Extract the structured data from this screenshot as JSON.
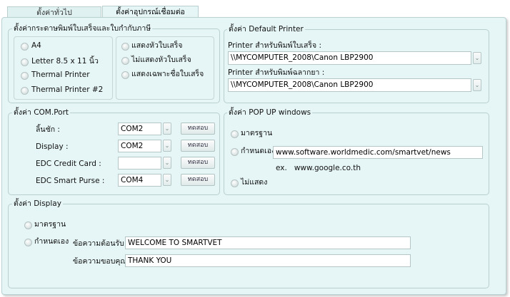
{
  "tabs": [
    "ตั้งค่าทั่วไป",
    "ตั้งค่าอุปกรณ์เชื่อมต่อ"
  ],
  "paper": {
    "title": "ตั้งค่ากระดาษพิมพ์ใบเสร็จและใบกำกับภาษี",
    "sizes": [
      "A4",
      "Letter 8.5 x 11 นิ้ว",
      "Thermal Printer",
      "Thermal Printer #2"
    ],
    "selected_size": "A4",
    "header_options": [
      "แสดงหัวใบเสร็จ",
      "ไม่แสดงหัวใบเสร็จ",
      "แสดงเฉพาะชื่อใบเสร็จ"
    ],
    "selected_header": "แสดงหัวใบเสร็จ"
  },
  "printer": {
    "title": "ตั้งค่า Default Printer",
    "receipt_label": "Printer สำหรับพิมพ์ใบเสร็จ :",
    "receipt_value": "\\\\MYCOMPUTER_2008\\Canon LBP2900",
    "label_label": "Printer สำหรับพิมพ์ฉลากยา :",
    "label_value": "\\\\MYCOMPUTER_2008\\Canon LBP2900"
  },
  "com": {
    "title": "ตั้งค่า COM.Port",
    "test_label": "ทดสอบ",
    "rows": [
      {
        "label": "ลิ้นชัก :",
        "value": "COM2"
      },
      {
        "label": "Display :",
        "value": "COM2"
      },
      {
        "label": "EDC Credit Card :",
        "value": ""
      },
      {
        "label": "EDC Smart Purse :",
        "value": "COM4"
      }
    ]
  },
  "popup": {
    "title": "ตั้งค่า POP UP windows",
    "standard": "มาตรฐาน",
    "custom": "กำหนดเอง",
    "url": "www.software.worldmedic.com/smartvet/news",
    "example": "ex.   www.google.co.th",
    "hide": "ไม่แสดง",
    "selected": "มาตรฐาน"
  },
  "display": {
    "title": "ตั้งค่า Display",
    "standard": "มาตรฐาน",
    "custom": "กำหนดเอง",
    "welcome_label": "ข้อความต้อนรับ :",
    "welcome_value": "WELCOME TO SMARTVET",
    "thanks_label": "ข้อความขอบคุณ :",
    "thanks_value": "THANK YOU",
    "selected": "กำหนดเอง"
  }
}
